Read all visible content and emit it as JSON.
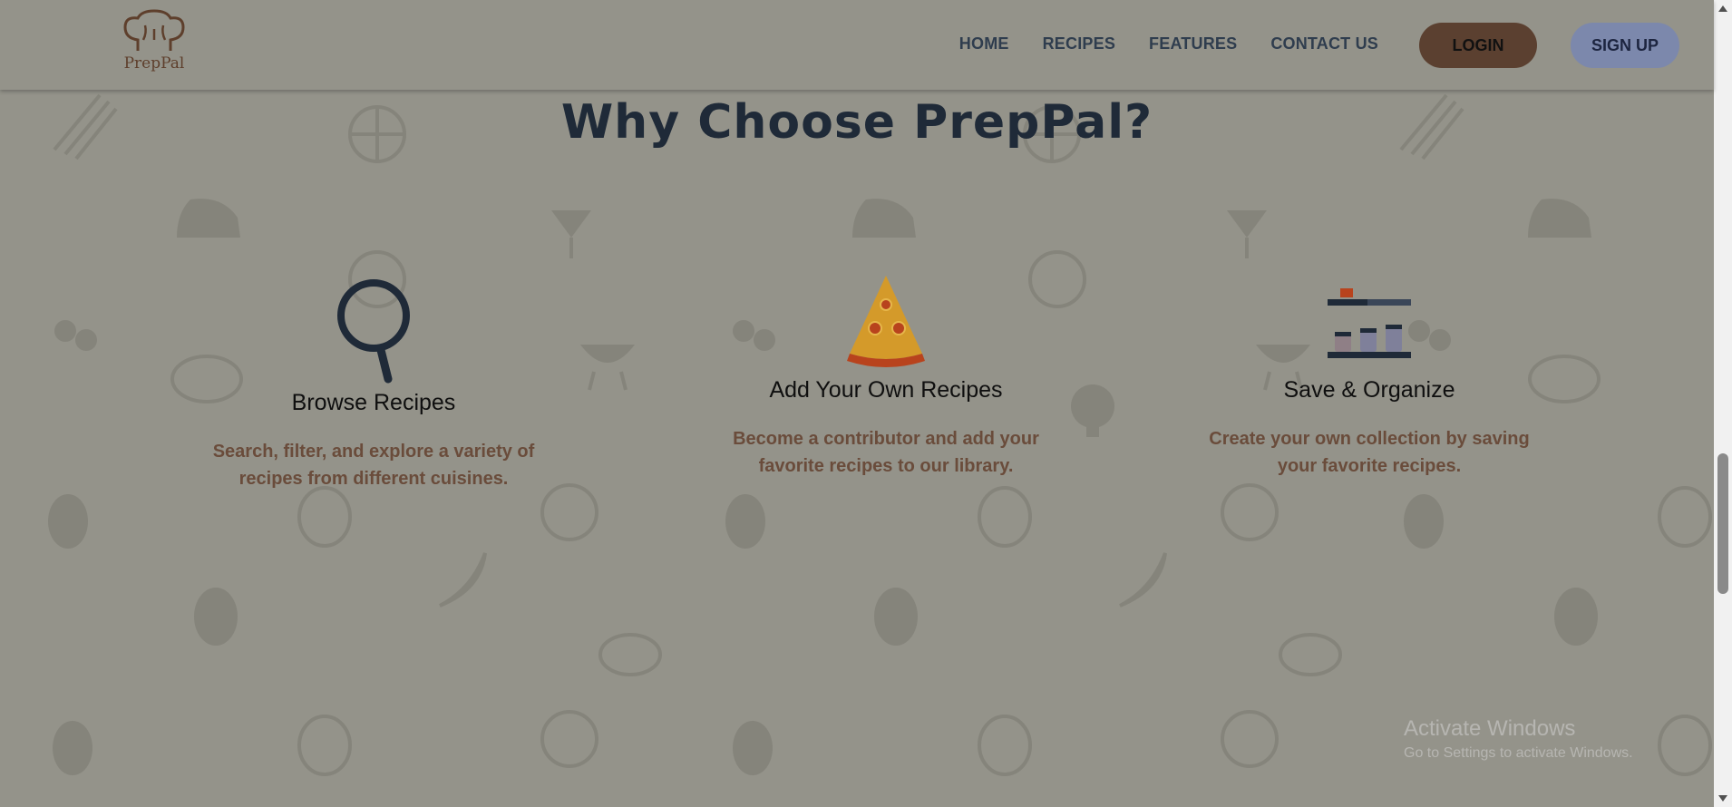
{
  "brand": {
    "name": "PrepPal"
  },
  "nav": {
    "items": [
      "HOME",
      "RECIPES",
      "FEATURES",
      "CONTACT US"
    ],
    "login_label": "LOGIN",
    "signup_label": "SIGN UP"
  },
  "section": {
    "title": "Why Choose PrepPal?",
    "features": [
      {
        "icon": "magnifier-icon",
        "title": "Browse Recipes",
        "description": "Search, filter, and explore a variety of recipes from different cuisines."
      },
      {
        "icon": "pizza-slice-icon",
        "title": "Add Your Own Recipes",
        "description": "Become a contributor and add your favorite recipes to our library."
      },
      {
        "icon": "spice-shelf-icon",
        "title": "Save & Organize",
        "description": "Create your own collection by saving your favorite recipes."
      }
    ]
  },
  "watermark": {
    "title": "Activate Windows",
    "subtitle": "Go to Settings to activate Windows."
  },
  "colors": {
    "overlay_background": "#94938a",
    "title": "#1f2a38",
    "description": "#6a4c3b",
    "login_button": "#5b4030",
    "signup_button": "#7c88ac"
  }
}
